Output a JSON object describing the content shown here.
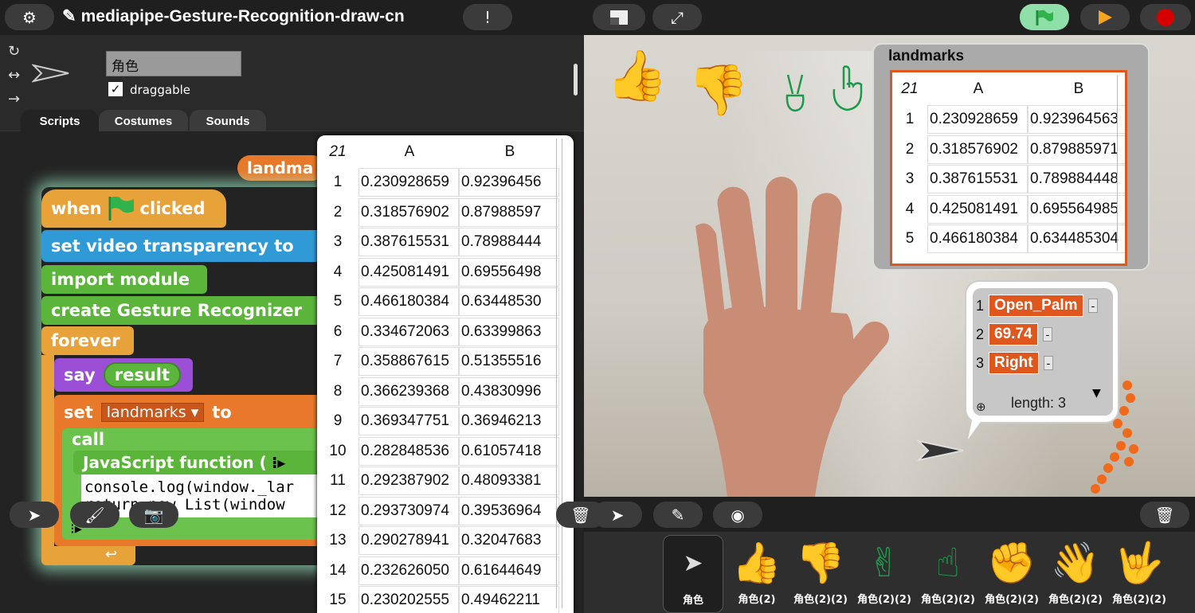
{
  "topbar": {
    "project_title": "mediapipe-Gesture-Recognition-draw-cn"
  },
  "sprite": {
    "name": "角色",
    "draggable_label": "draggable"
  },
  "tabs": [
    "Scripts",
    "Costumes",
    "Sounds"
  ],
  "blocks": {
    "hat_var": "landma",
    "when": "when",
    "clicked": "clicked",
    "set_video": "set video transparency to",
    "import_module": "import module",
    "create_recognizer": "create Gesture Recognizer",
    "forever": "forever",
    "say": "say",
    "result": "result",
    "set": "set",
    "set_var": "landmarks",
    "to": "to",
    "call": "call",
    "js_function": "JavaScript function (",
    "code_line1": "console.log(window._lar",
    "code_line2": "return new List(window"
  },
  "script_table": {
    "corner": "21",
    "columns": [
      "A",
      "B"
    ],
    "rows": [
      {
        "i": "1",
        "a": "0.230928659",
        "b": "0.92396456"
      },
      {
        "i": "2",
        "a": "0.318576902",
        "b": "0.87988597"
      },
      {
        "i": "3",
        "a": "0.387615531",
        "b": "0.78988444"
      },
      {
        "i": "4",
        "a": "0.425081491",
        "b": "0.69556498"
      },
      {
        "i": "5",
        "a": "0.466180384",
        "b": "0.63448530"
      },
      {
        "i": "6",
        "a": "0.334672063",
        "b": "0.63399863"
      },
      {
        "i": "7",
        "a": "0.358867615",
        "b": "0.51355516"
      },
      {
        "i": "8",
        "a": "0.366239368",
        "b": "0.43830996"
      },
      {
        "i": "9",
        "a": "0.369347751",
        "b": "0.36946213"
      },
      {
        "i": "10",
        "a": "0.282848536",
        "b": "0.61057418"
      },
      {
        "i": "11",
        "a": "0.292387902",
        "b": "0.48093381"
      },
      {
        "i": "12",
        "a": "0.293730974",
        "b": "0.39536964"
      },
      {
        "i": "13",
        "a": "0.290278941",
        "b": "0.32047683"
      },
      {
        "i": "14",
        "a": "0.232626050",
        "b": "0.61644649"
      },
      {
        "i": "15",
        "a": "0.230202555",
        "b": "0.49462211"
      }
    ]
  },
  "stage_watcher": {
    "title": "landmarks",
    "corner": "21",
    "columns": [
      "A",
      "B"
    ],
    "rows": [
      {
        "i": "1",
        "a": "0.230928659",
        "b": "0.923964563"
      },
      {
        "i": "2",
        "a": "0.318576902",
        "b": "0.879885971"
      },
      {
        "i": "3",
        "a": "0.387615531",
        "b": "0.789884448"
      },
      {
        "i": "4",
        "a": "0.425081491",
        "b": "0.695564985"
      },
      {
        "i": "5",
        "a": "0.466180384",
        "b": "0.634485304"
      }
    ]
  },
  "speech_list": {
    "items": [
      {
        "i": "1",
        "v": "Open_Palm"
      },
      {
        "i": "2",
        "v": "69.74"
      },
      {
        "i": "3",
        "v": "Right"
      }
    ],
    "length_label": "length: 3"
  },
  "stage_icons": [
    "thumbs-up-icon",
    "thumbs-down-icon",
    "victory-icon",
    "pointing-up-icon"
  ],
  "corral_sprites": [
    {
      "name": "角色",
      "icon": "arrow-icon"
    },
    {
      "name": "角色(2)",
      "icon": "thumbs-up-icon"
    },
    {
      "name": "角色(2)(2)",
      "icon": "thumbs-down-icon"
    },
    {
      "name": "角色(2)(2)",
      "icon": "victory-icon"
    },
    {
      "name": "角色(2)(2)",
      "icon": "pointing-up-icon"
    },
    {
      "name": "角色(2)(2)",
      "icon": "fist-icon"
    },
    {
      "name": "角色(2)(2)",
      "icon": "waving-hand-icon"
    },
    {
      "name": "角色(2)(2)",
      "icon": "love-you-icon"
    }
  ],
  "colors": {
    "flag_green": "#2fb34a",
    "play_orange": "#f7a51e",
    "stop_red": "#d60000",
    "block_orange": "#e8a23a",
    "list_orange": "#e0571e"
  }
}
